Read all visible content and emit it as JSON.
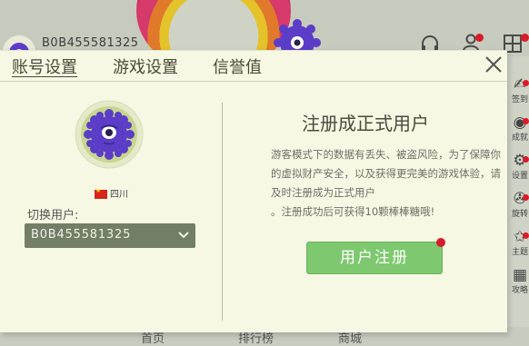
{
  "topbar": {
    "user_id": "B0B455581325",
    "headset_icon": "headset-icon",
    "user_icon": "user-icon"
  },
  "right_menu": [
    {
      "icon": "sign-in-icon",
      "label": "签到"
    },
    {
      "icon": "eye-icon",
      "label": "成就"
    },
    {
      "icon": "gear-icon",
      "label": "设置"
    },
    {
      "icon": "fan-icon",
      "label": "旋转"
    },
    {
      "icon": "star-icon",
      "label": "主题"
    },
    {
      "icon": "grid-icon",
      "label": "攻略"
    }
  ],
  "bottom": [
    "首页",
    "排行榜",
    "商城"
  ],
  "dialog": {
    "tabs": [
      "账号设置",
      "游戏设置",
      "信誉值"
    ],
    "active_tab": "账号设置",
    "region": "四川",
    "switch_label": "切换用户:",
    "selected_user": "B0B455581325",
    "register_title": "注册成正式用户",
    "register_desc_1": "游客模式下的数据有丢失、被盗风险，为了保障你的虚拟财产安全，以及获得更完美的游戏体验，请及时注册成为正式用户",
    "register_desc_2": "。注册成功后可获得10颗棒棒糖哦!",
    "register_button": "用户注册"
  },
  "colors": {
    "dialog_bg": "#f6f8e4",
    "select_bg": "#737e66",
    "button_green": "#7ec86f",
    "badge_red": "#d81b2a",
    "monster_purple": "#5b3dc8"
  }
}
